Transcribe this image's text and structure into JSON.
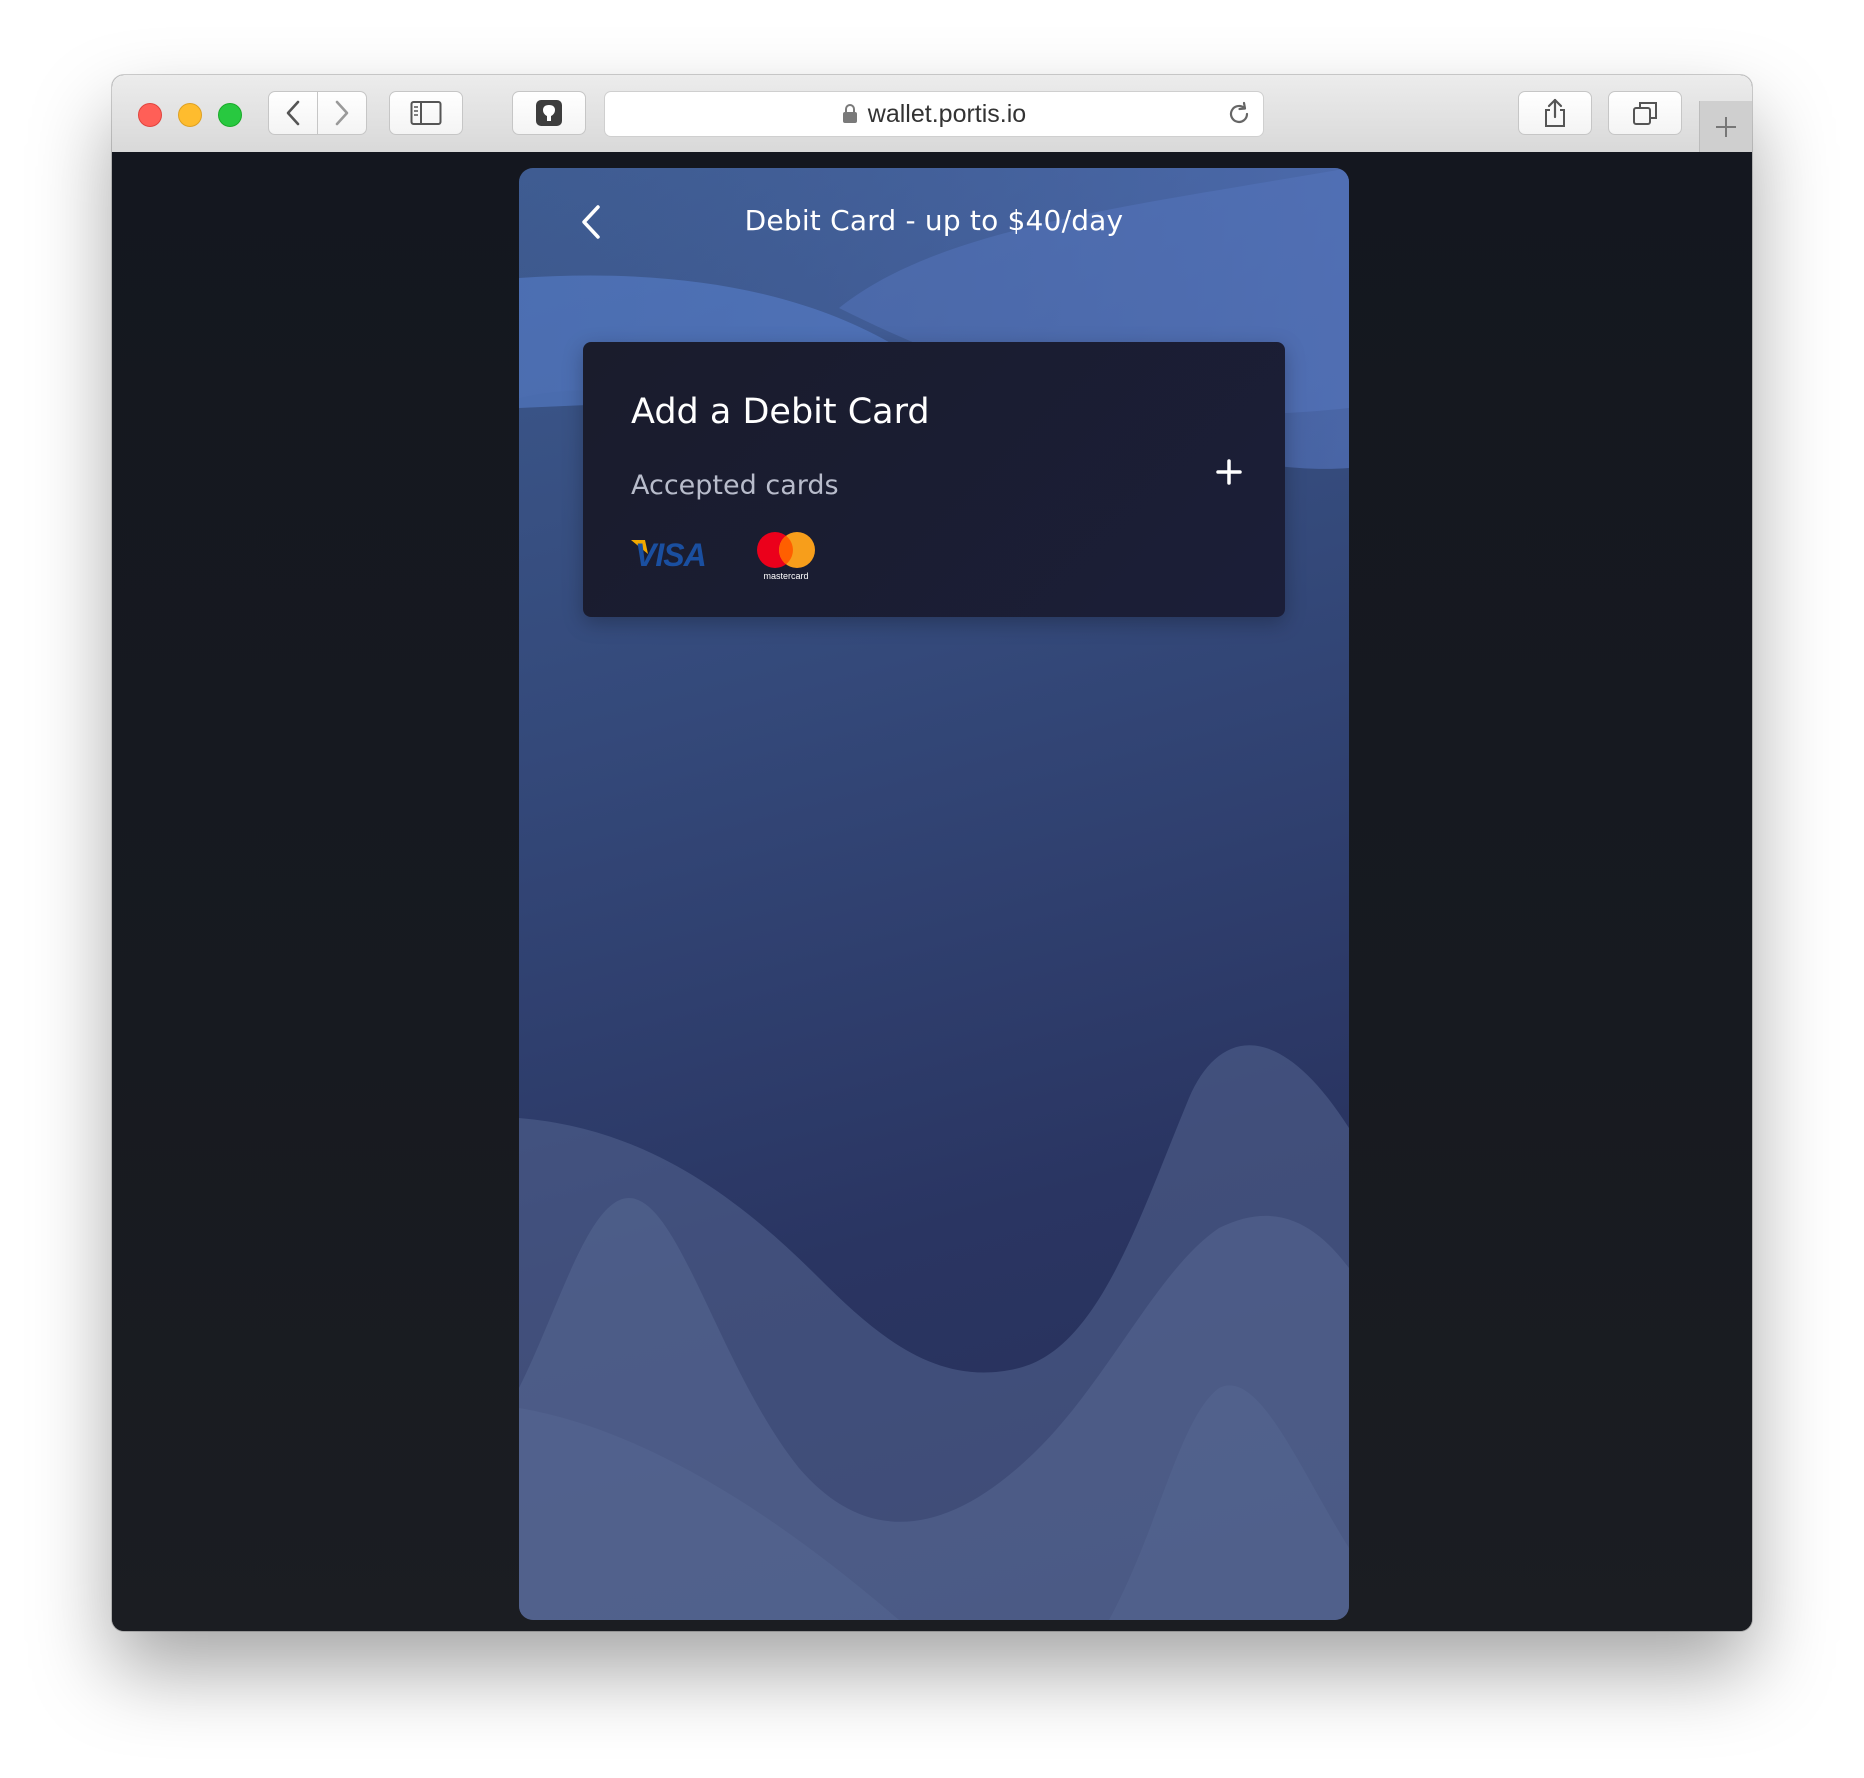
{
  "browser": {
    "url": "wallet.portis.io",
    "traffic_lights": {
      "close": "#ff5f57",
      "minimize": "#febc2e",
      "zoom": "#28c840"
    },
    "icons": [
      "back-icon",
      "forward-icon",
      "sidebar-icon",
      "shield-extension-icon",
      "lock-icon",
      "reload-icon",
      "share-icon",
      "tabs-icon",
      "plus-icon"
    ]
  },
  "page": {
    "header": {
      "title": "Debit Card - up to $40/day"
    },
    "card": {
      "title": "Add a Debit Card",
      "subtitle": "Accepted cards",
      "logos": {
        "visa": "VISA",
        "mastercard": "mastercard"
      }
    },
    "colors": {
      "panel_top": "#3d5a8e",
      "panel_bottom": "#262f58",
      "card_bg": "#1b1e38",
      "visa_blue": "#1a4fa0",
      "visa_gold": "#f2a900",
      "mc_red": "#eb001b",
      "mc_orange": "#f79e1b"
    }
  }
}
